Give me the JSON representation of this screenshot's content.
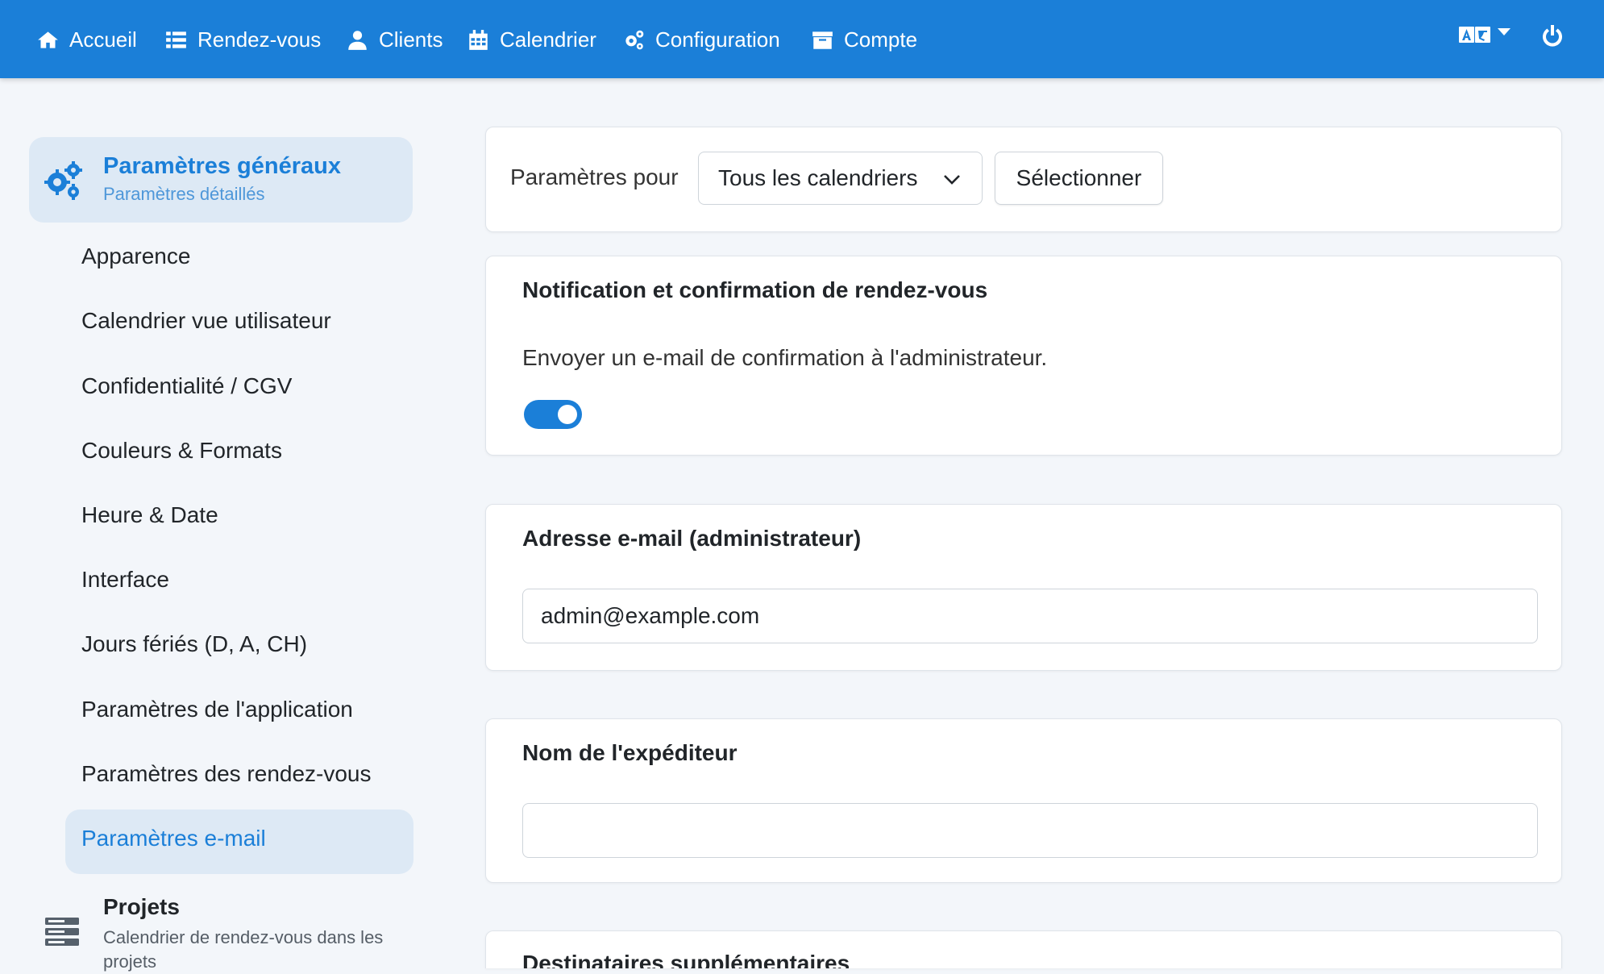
{
  "nav": {
    "items": [
      {
        "label": "Accueil",
        "icon": "home-icon"
      },
      {
        "label": "Rendez-vous",
        "icon": "list-icon"
      },
      {
        "label": "Clients",
        "icon": "user-icon"
      },
      {
        "label": "Calendrier",
        "icon": "calendar-icon"
      },
      {
        "label": "Configuration",
        "icon": "cogs-icon"
      },
      {
        "label": "Compte",
        "icon": "archive-icon"
      }
    ],
    "language_icon": "language-icon",
    "power_icon": "power-icon"
  },
  "sidebar": {
    "section_title": "Paramètres généraux",
    "section_subtitle": "Paramètres détaillés",
    "items": [
      "Apparence",
      "Calendrier vue utilisateur",
      "Confidentialité / CGV",
      "Couleurs & Formats",
      "Heure & Date",
      "Interface",
      "Jours fériés (D, A, CH)",
      "Paramètres de l'application",
      "Paramètres des rendez-vous",
      "Paramètres e-mail"
    ],
    "active_item": "Paramètres e-mail",
    "projects_title": "Projets",
    "projects_subtitle": "Calendrier de rendez-vous dans les projets"
  },
  "filter": {
    "label": "Paramètres pour",
    "selected": "Tous les calendriers",
    "button": "Sélectionner"
  },
  "notification": {
    "title": "Notification et confirmation de rendez-vous",
    "description": "Envoyer un e-mail de confirmation à l'administrateur.",
    "toggle_on": true
  },
  "admin_email": {
    "title": "Adresse e-mail (administrateur)",
    "value": "admin@example.com"
  },
  "sender_name": {
    "title": "Nom de l'expéditeur",
    "value": ""
  },
  "extra_recipients": {
    "title": "Destinataires supplémentaires"
  },
  "colors": {
    "accent": "#1b7fd8",
    "active_bg": "#dde9f5"
  }
}
